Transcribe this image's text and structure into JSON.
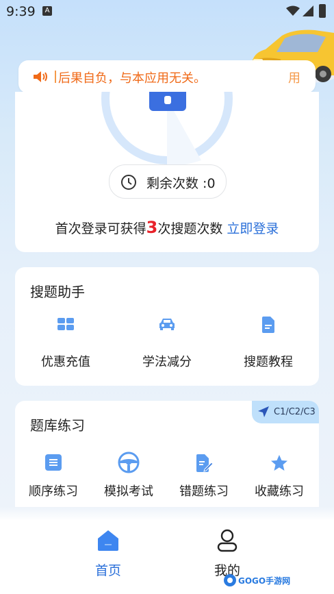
{
  "status_bar": {
    "time": "9:39",
    "a_icon": "A"
  },
  "notice": {
    "text": "后果自负，与本应用无关。",
    "tail": "用"
  },
  "top_card": {
    "remaining_label": "剩余次数 :0",
    "login_prefix": "首次登录可获得",
    "login_number": "3",
    "login_suffix": "次搜题次数",
    "login_link": "立即登录"
  },
  "assistant": {
    "title": "搜题助手",
    "items": [
      {
        "label": "优惠充值",
        "icon": "voucher-icon"
      },
      {
        "label": "学法减分",
        "icon": "car-icon"
      },
      {
        "label": "搜题教程",
        "icon": "document-icon"
      }
    ]
  },
  "practice": {
    "title": "题库练习",
    "tag": "C1/C2/C3",
    "items": [
      {
        "label": "顺序练习",
        "icon": "list-icon"
      },
      {
        "label": "模拟考试",
        "icon": "steering-wheel-icon"
      },
      {
        "label": "错题练习",
        "icon": "edit-doc-icon"
      },
      {
        "label": "收藏练习",
        "icon": "star-icon"
      }
    ]
  },
  "tabbar": {
    "home": "首页",
    "mine": "我的",
    "active_color": "#2a6fd9"
  },
  "watermark": {
    "text": "GOGO手游网"
  },
  "colors": {
    "accent": "#5b9cf0",
    "orange": "#f06a18",
    "red": "#e8222a",
    "link": "#2a6fd9"
  }
}
